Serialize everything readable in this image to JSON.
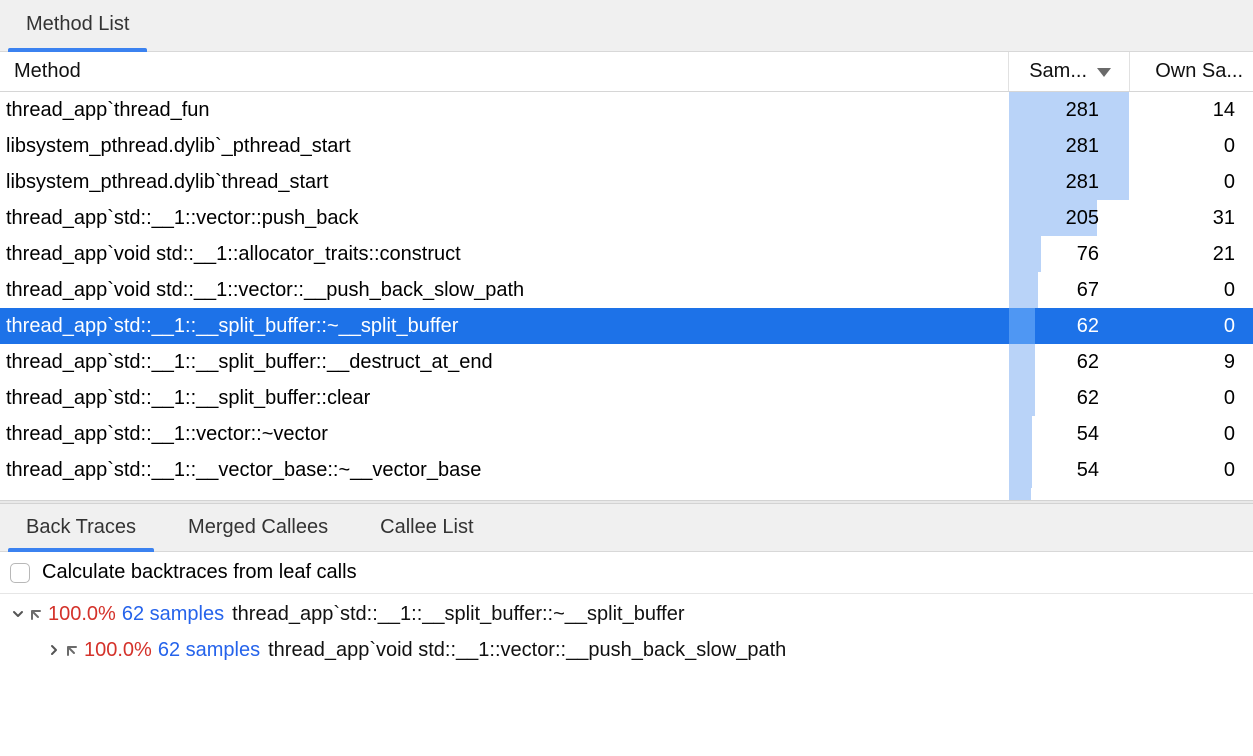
{
  "top_tabs": {
    "method_list": "Method List"
  },
  "columns": {
    "method": "Method",
    "samples": "Sam...",
    "own_samples": "Own Sa..."
  },
  "max_samples": 281,
  "rows": [
    {
      "method": "thread_app`thread_fun",
      "samples": 281,
      "own": 14,
      "selected": false
    },
    {
      "method": "libsystem_pthread.dylib`_pthread_start",
      "samples": 281,
      "own": 0,
      "selected": false
    },
    {
      "method": "libsystem_pthread.dylib`thread_start",
      "samples": 281,
      "own": 0,
      "selected": false
    },
    {
      "method": "thread_app`std::__1::vector::push_back",
      "samples": 205,
      "own": 31,
      "selected": false
    },
    {
      "method": "thread_app`void std::__1::allocator_traits::construct",
      "samples": 76,
      "own": 21,
      "selected": false
    },
    {
      "method": "thread_app`void std::__1::vector::__push_back_slow_path",
      "samples": 67,
      "own": 0,
      "selected": false
    },
    {
      "method": "thread_app`std::__1::__split_buffer::~__split_buffer",
      "samples": 62,
      "own": 0,
      "selected": true
    },
    {
      "method": "thread_app`std::__1::__split_buffer::__destruct_at_end",
      "samples": 62,
      "own": 9,
      "selected": false
    },
    {
      "method": "thread_app`std::__1::__split_buffer::clear",
      "samples": 62,
      "own": 0,
      "selected": false
    },
    {
      "method": "thread_app`std::__1::vector::~vector",
      "samples": 54,
      "own": 0,
      "selected": false
    },
    {
      "method": "thread_app`std::__1::__vector_base::~__vector_base",
      "samples": 54,
      "own": 0,
      "selected": false
    }
  ],
  "partial_row_samples": 50,
  "lower_tabs": {
    "back_traces": "Back Traces",
    "merged_callees": "Merged Callees",
    "callee_list": "Callee List"
  },
  "checkbox_label": "Calculate backtraces from leaf calls",
  "backtrace": [
    {
      "indent": 0,
      "expanded": true,
      "pct": "100.0%",
      "samples": "62 samples",
      "method": "thread_app`std::__1::__split_buffer::~__split_buffer"
    },
    {
      "indent": 1,
      "expanded": false,
      "pct": "100.0%",
      "samples": "62 samples",
      "method": "thread_app`void std::__1::vector::__push_back_slow_path"
    }
  ]
}
